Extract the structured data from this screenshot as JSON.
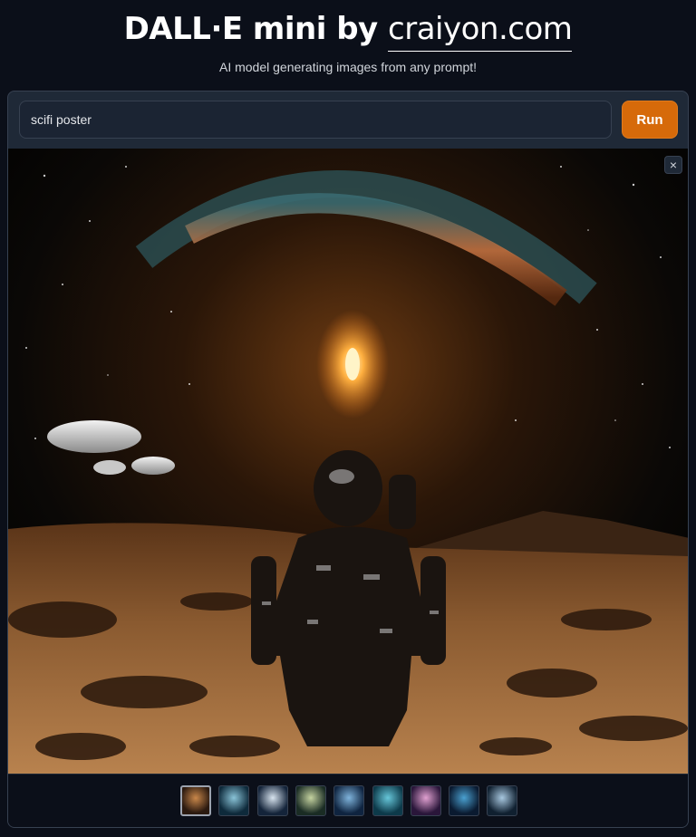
{
  "header": {
    "title_main": "DALL·E mini by ",
    "title_brand": "craiyon.com",
    "subtitle": "AI model generating images from any prompt!"
  },
  "prompt": {
    "value": "scifi poster"
  },
  "run_button": {
    "label": "Run"
  },
  "gallery": {
    "close_label": "×",
    "thumbnail_count": 9,
    "selected_index": 0,
    "thumbnails": [
      {
        "bg": "#2b1a10",
        "accent": "#c9874a"
      },
      {
        "bg": "#0e2a3b",
        "accent": "#8ac4d8"
      },
      {
        "bg": "#14243a",
        "accent": "#d8e4ef"
      },
      {
        "bg": "#1a2c24",
        "accent": "#c5d3a0"
      },
      {
        "bg": "#0f2440",
        "accent": "#7fb4dc"
      },
      {
        "bg": "#0d3a4a",
        "accent": "#66c6d9"
      },
      {
        "bg": "#2a163a",
        "accent": "#e0a0d0"
      },
      {
        "bg": "#0a1a30",
        "accent": "#4aa0d0"
      },
      {
        "bg": "#102030",
        "accent": "#a8c8e0"
      }
    ]
  },
  "colors": {
    "background": "#0b0f19",
    "panel": "#1f2937",
    "accent_run": "#d66a0a"
  }
}
